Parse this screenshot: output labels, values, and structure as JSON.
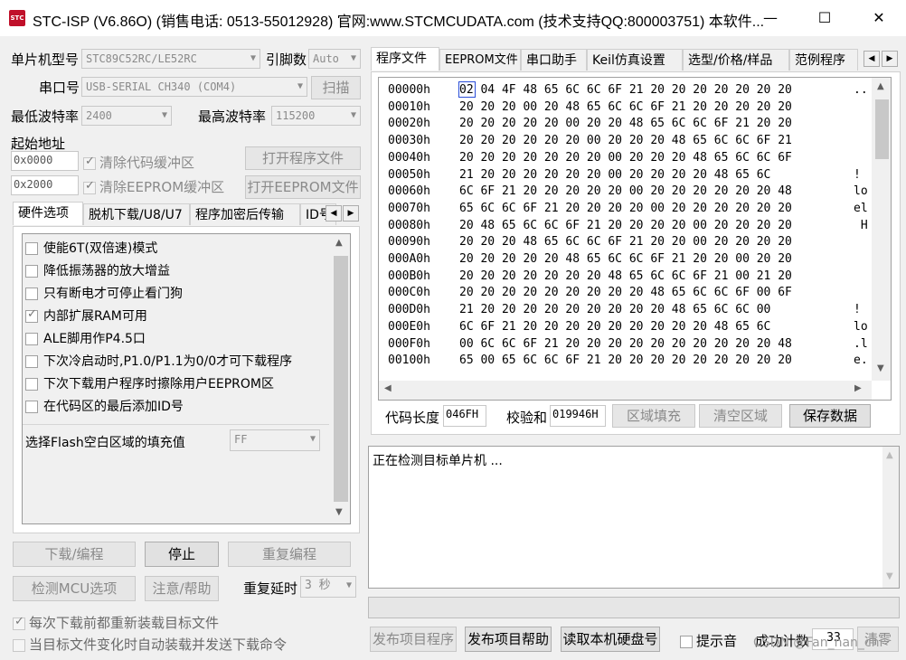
{
  "window": {
    "title": "STC-ISP (V6.86O) (销售电话: 0513-55012928) 官网:www.STCMCUDATA.com  (技术支持QQ:800003751) 本软件...",
    "icon": "STC",
    "minimize": "—",
    "maximize": "☐",
    "close": "✕"
  },
  "left": {
    "mcu_type_label": "单片机型号",
    "mcu_type_value": "STC89C52RC/LE52RC",
    "pins_label": "引脚数",
    "pins_value": "Auto",
    "port_label": "串口号",
    "port_value": "USB-SERIAL CH340 (COM4)",
    "scan_label": "扫描",
    "min_baud_label": "最低波特率",
    "min_baud_value": "2400",
    "max_baud_label": "最高波特率",
    "max_baud_value": "115200",
    "start_addr_label": "起始地址",
    "code_addr": "0x0000",
    "eeprom_addr": "0x2000",
    "clear_code_label": "清除代码缓冲区",
    "clear_eeprom_label": "清除EEPROM缓冲区",
    "open_program_label": "打开程序文件",
    "open_eeprom_label": "打开EEPROM文件",
    "tabs": [
      "硬件选项",
      "脱机下载/U8/U7",
      "程序加密后传输",
      "ID号"
    ],
    "options": [
      {
        "label": "使能6T(双倍速)模式",
        "checked": false
      },
      {
        "label": "降低振荡器的放大增益",
        "checked": false
      },
      {
        "label": "只有断电才可停止看门狗",
        "checked": false
      },
      {
        "label": "内部扩展RAM可用",
        "checked": true
      },
      {
        "label": "ALE脚用作P4.5口",
        "checked": false
      },
      {
        "label": "下次冷启动时,P1.0/P1.1为0/0才可下载程序",
        "checked": false
      },
      {
        "label": "下次下载用户程序时擦除用户EEPROM区",
        "checked": false
      },
      {
        "label": "在代码区的最后添加ID号",
        "checked": false
      }
    ],
    "fill_label": "选择Flash空白区域的填充值",
    "fill_value": "FF",
    "download_label": "下载/编程",
    "stop_label": "停止",
    "reprogram_label": "重复编程",
    "detect_label": "检测MCU选项",
    "help_label": "注意/帮助",
    "delay_label": "重复延时",
    "delay_value": "3 秒",
    "reload_label": "每次下载前都重新装载目标文件",
    "auto_label": "当目标文件变化时自动装载并发送下载命令"
  },
  "right": {
    "tabs": [
      "程序文件",
      "EEPROM文件",
      "串口助手",
      "Keil仿真设置",
      "选型/价格/样品",
      "范例程序"
    ],
    "hex_rows": [
      {
        "addr": "00000h",
        "bytes": "02 04 4F 48 65 6C 6C 6F 21 20 20 20 20 20 20 20",
        "ascii": ".."
      },
      {
        "addr": "00010h",
        "bytes": "20 20 20 00 20 48 65 6C 6C 6F 21 20 20 20 20 20",
        "ascii": ""
      },
      {
        "addr": "00020h",
        "bytes": "20 20 20 20 20 00 20 20 48 65 6C 6C 6F 21 20 20",
        "ascii": ""
      },
      {
        "addr": "00030h",
        "bytes": "20 20 20 20 20 20 00 20 20 20 48 65 6C 6C 6F 21",
        "ascii": ""
      },
      {
        "addr": "00040h",
        "bytes": "20 20 20 20 20 20 20 00 20 20 20 48 65 6C 6C 6F",
        "ascii": ""
      },
      {
        "addr": "00050h",
        "bytes": "21 20 20 20 20 20 20 00 20 20 20 20 48 65 6C",
        "ascii": "!"
      },
      {
        "addr": "00060h",
        "bytes": "6C 6F 21 20 20 20 20 20 00 20 20 20 20 20 20 48",
        "ascii": "lo"
      },
      {
        "addr": "00070h",
        "bytes": "65 6C 6C 6F 21 20 20 20 20 00 20 20 20 20 20 20",
        "ascii": "el"
      },
      {
        "addr": "00080h",
        "bytes": "20 48 65 6C 6C 6F 21 20 20 20 20 00 20 20 20 20",
        "ascii": " H"
      },
      {
        "addr": "00090h",
        "bytes": "20 20 20 48 65 6C 6C 6F 21 20 20 00 20 20 20 20",
        "ascii": ""
      },
      {
        "addr": "000A0h",
        "bytes": "20 20 20 20 20 48 65 6C 6C 6F 21 20 20 00 20 20",
        "ascii": ""
      },
      {
        "addr": "000B0h",
        "bytes": "20 20 20 20 20 20 20 48 65 6C 6C 6F 21 00 21 20",
        "ascii": ""
      },
      {
        "addr": "000C0h",
        "bytes": "20 20 20 20 20 20 20 20 20 48 65 6C 6C 6F 00 6F",
        "ascii": ""
      },
      {
        "addr": "000D0h",
        "bytes": "21 20 20 20 20 20 20 20 20 20 48 65 6C 6C 00",
        "ascii": "!"
      },
      {
        "addr": "000E0h",
        "bytes": "6C 6F 21 20 20 20 20 20 20 20 20 20 48 65 6C",
        "ascii": "lo"
      },
      {
        "addr": "000F0h",
        "bytes": "00 6C 6C 6F 21 20 20 20 20 20 20 20 20 20 20 48",
        "ascii": ".l"
      },
      {
        "addr": "00100h",
        "bytes": "65 00 65 6C 6C 6F 21 20 20 20 20 20 20 20 20 20",
        "ascii": "e."
      }
    ],
    "code_len_label": "代码长度",
    "code_len_value": "046FH",
    "checksum_label": "校验和",
    "checksum_value": "019946H",
    "fill_area_label": "区域填充",
    "clear_area_label": "清空区域",
    "save_label": "保存数据",
    "log_text": "正在检测目标单片机 ...",
    "publish_program_label": "发布项目程序",
    "publish_help_label": "发布项目帮助",
    "read_disk_label": "读取本机硬盘号",
    "beep_label": "提示音",
    "success_count_label": "成功计数",
    "success_count_value": "33",
    "clear_label": "清零",
    "watermark": "CSDN @Fan_nan_chi"
  }
}
